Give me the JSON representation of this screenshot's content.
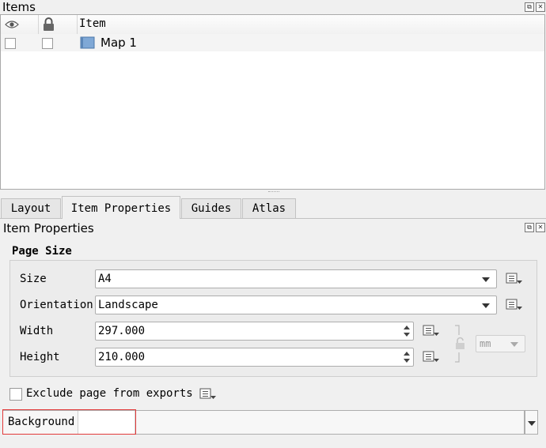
{
  "items_panel": {
    "title": "Items",
    "column_item": "Item",
    "rows": [
      {
        "label": "Map 1",
        "visible": false,
        "locked": false
      }
    ]
  },
  "tabs": [
    {
      "label": "Layout",
      "active": false
    },
    {
      "label": "Item Properties",
      "active": true
    },
    {
      "label": "Guides",
      "active": false
    },
    {
      "label": "Atlas",
      "active": false
    }
  ],
  "properties_panel": {
    "title": "Item Properties",
    "group_title": "Page Size",
    "size": {
      "label": "Size",
      "value": "A4"
    },
    "orientation": {
      "label": "Orientation",
      "value": "Landscape"
    },
    "width": {
      "label": "Width",
      "value": "297.000"
    },
    "height": {
      "label": "Height",
      "value": "210.000"
    },
    "units": {
      "value": "mm"
    },
    "exclude": {
      "label": "Exclude page from exports",
      "checked": false
    },
    "background": {
      "label": "Background"
    }
  },
  "colors": {
    "highlight": "#e23a3a",
    "map_icon": "#6a98c8"
  }
}
